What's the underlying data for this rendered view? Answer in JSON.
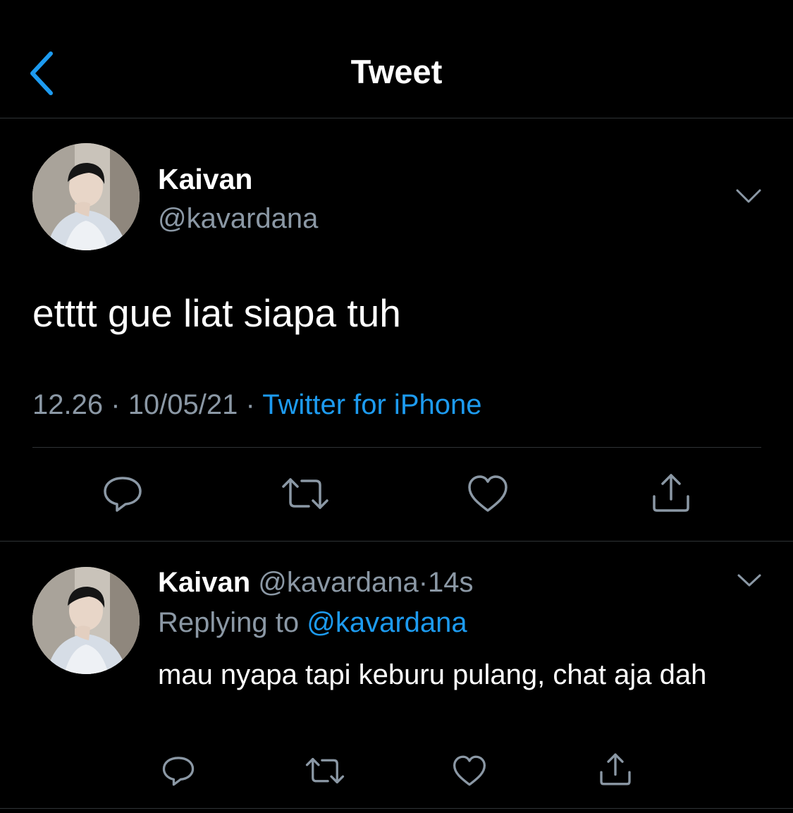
{
  "header": {
    "back_icon": "chevron-left-icon",
    "title": "Tweet"
  },
  "colors": {
    "background": "#000000",
    "accent": "#1d9bf0",
    "secondary_text": "#8b98a5",
    "divider": "#2f3336"
  },
  "main_tweet": {
    "display_name": "Kaivan",
    "handle": "@kavardana",
    "text": "etttt gue liat siapa tuh",
    "time": "12.26",
    "separator": "·",
    "date": "10/05/21",
    "source": "Twitter for iPhone",
    "actions": [
      "reply-icon",
      "retweet-icon",
      "like-icon",
      "share-icon"
    ]
  },
  "reply_tweet": {
    "display_name": "Kaivan",
    "handle": "@kavardana",
    "separator": "·",
    "timestamp": "14s",
    "replying_label": "Replying to",
    "replying_to": "@kavardana",
    "text": "mau nyapa tapi keburu pulang, chat aja dah",
    "actions": [
      "reply-icon",
      "retweet-icon",
      "like-icon",
      "share-icon"
    ]
  }
}
